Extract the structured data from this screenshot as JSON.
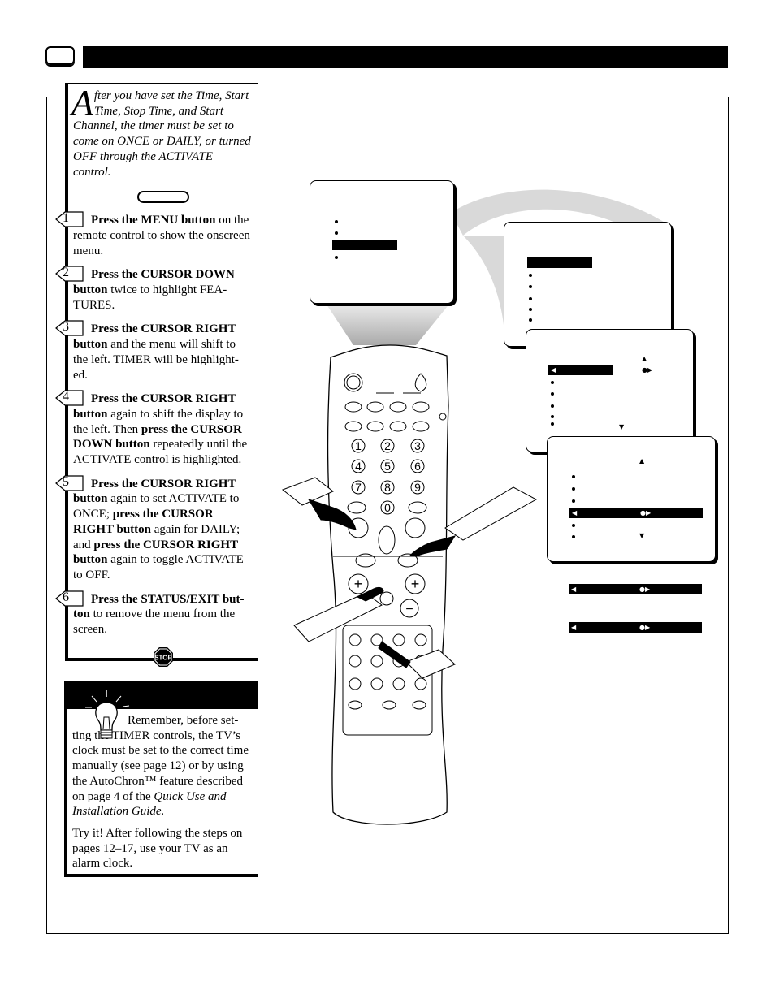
{
  "intro": {
    "dropcap": "A",
    "text": "fter you have set the Time, Start Time, Stop Time, and Start Channel, the timer must be set to come on ONCE or DAILY,  or turned OFF through the ACTIVATE control."
  },
  "steps": [
    {
      "number": "1",
      "segments": [
        {
          "t": "Press the MENU button",
          "b": true
        },
        {
          "t": " on the remote control to show the onscreen menu."
        }
      ]
    },
    {
      "number": "2",
      "segments": [
        {
          "t": "Press the CURSOR DOWN button",
          "b": true
        },
        {
          "t": " twice to highlight FEA-TURES."
        }
      ]
    },
    {
      "number": "3",
      "segments": [
        {
          "t": "Press the CURSOR RIGHT button",
          "b": true
        },
        {
          "t": " and the menu will shift to the left. TIMER will be highlight-ed."
        }
      ]
    },
    {
      "number": "4",
      "segments": [
        {
          "t": "Press the CURSOR RIGHT button",
          "b": true
        },
        {
          "t": " again to shift the display to the left. Then "
        },
        {
          "t": "press the CURSOR DOWN button",
          "b": true
        },
        {
          "t": " repeatedly until the ACTIVATE control is highlighted."
        }
      ]
    },
    {
      "number": "5",
      "segments": [
        {
          "t": "Press the CURSOR RIGHT button",
          "b": true
        },
        {
          "t": " again to set ACTIVATE to ONCE; "
        },
        {
          "t": "press the CURSOR RIGHT button",
          "b": true
        },
        {
          "t": " again for DAILY; and "
        },
        {
          "t": "press the CURSOR RIGHT button",
          "b": true
        },
        {
          "t": " again to toggle ACTIVATE to OFF."
        }
      ]
    },
    {
      "number": "6",
      "segments": [
        {
          "t": "Press the STATUS/EXIT but-ton",
          "b": true
        },
        {
          "t": " to remove the menu from the screen."
        }
      ]
    }
  ],
  "stop_sign": "STOP",
  "tip": {
    "para1": "Remember, before set-ting the TIMER controls, the TV’s clock must be set to the correct time manually (see page 12) or by using the AutoChron™ feature described on page 4 of the ",
    "para1_italic": "Quick Use and Installation Guide.",
    "para2": "Try it! After following the steps on pages 12–17, use your TV as an alarm clock."
  },
  "remote": {
    "digits": [
      "1",
      "2",
      "3",
      "4",
      "5",
      "6",
      "7",
      "8",
      "9",
      "0"
    ],
    "plus": "+",
    "minus": "−"
  },
  "icons": [
    "tv-icon",
    "lightbulb-icon",
    "stop-sign-icon",
    "remote-control",
    "pointing-hand-icon"
  ]
}
